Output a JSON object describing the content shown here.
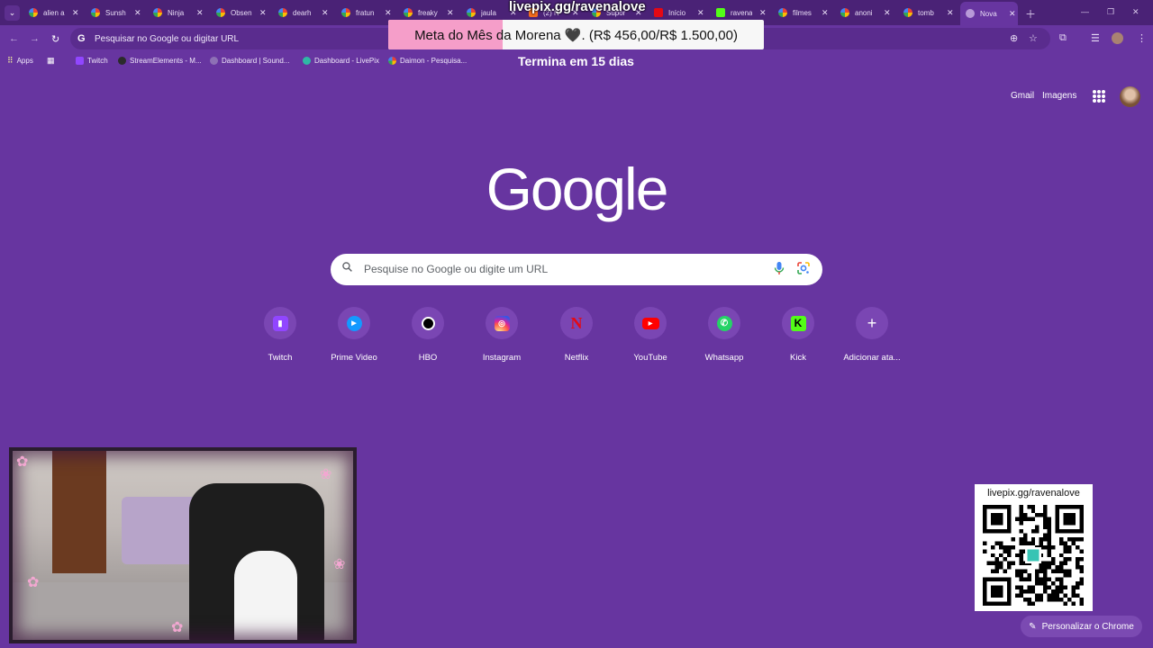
{
  "tabs": [
    {
      "title": "alien a",
      "icon": "google"
    },
    {
      "title": "Sunsh",
      "icon": "google"
    },
    {
      "title": "Ninja",
      "icon": "google"
    },
    {
      "title": "Obsen",
      "icon": "google"
    },
    {
      "title": "dearh",
      "icon": "google"
    },
    {
      "title": "fratun",
      "icon": "google"
    },
    {
      "title": "freaky",
      "icon": "google"
    },
    {
      "title": "jaula",
      "icon": "google"
    },
    {
      "title": "(2) N",
      "icon": "youtube"
    },
    {
      "title": "Supor",
      "icon": "google"
    },
    {
      "title": "Início",
      "icon": "netflix"
    },
    {
      "title": "ravena",
      "icon": "kick"
    },
    {
      "title": "filmes",
      "icon": "google"
    },
    {
      "title": "anoni",
      "icon": "google"
    },
    {
      "title": "tomb",
      "icon": "google"
    },
    {
      "title": "Nova",
      "icon": "chrome",
      "active": true
    }
  ],
  "toolbar": {
    "omnibox_text": "Pesquisar no Google ou digitar URL"
  },
  "bookmarks": [
    {
      "label": "Apps",
      "icon": "apps-icon"
    },
    {
      "label": "",
      "icon": "grid-icon"
    },
    {
      "label": "Twitch",
      "icon": "twitch-icon"
    },
    {
      "label": "StreamElements - M...",
      "icon": "streamelements-icon"
    },
    {
      "label": "Dashboard | Sound...",
      "icon": "soundcloud-icon"
    },
    {
      "label": "Dashboard - LivePix",
      "icon": "livepix-icon"
    },
    {
      "label": "Daimon - Pesquisa...",
      "icon": "google-icon"
    }
  ],
  "overlay": {
    "livepix_top": "livepix.gg/ravenalove",
    "goal_text": "Meta do Mês da Morena 🖤. (R$ 456,00/R$ 1.500,00)",
    "goal_fraction": 0.304,
    "goal_days": "Termina em 15 dias",
    "qr_label": "livepix.gg/ravenalove"
  },
  "ntp": {
    "gmail": "Gmail",
    "images": "Imagens",
    "logo": "Google",
    "search_placeholder": "Pesquise no Google ou digite um URL",
    "shortcuts": [
      {
        "label": "Twitch"
      },
      {
        "label": "Prime Video"
      },
      {
        "label": "HBO"
      },
      {
        "label": "Instagram"
      },
      {
        "label": "Netflix"
      },
      {
        "label": "YouTube"
      },
      {
        "label": "Whatsapp"
      },
      {
        "label": "Kick"
      },
      {
        "label": "Adicionar ata..."
      }
    ],
    "customize": "Personalizar o Chrome"
  }
}
